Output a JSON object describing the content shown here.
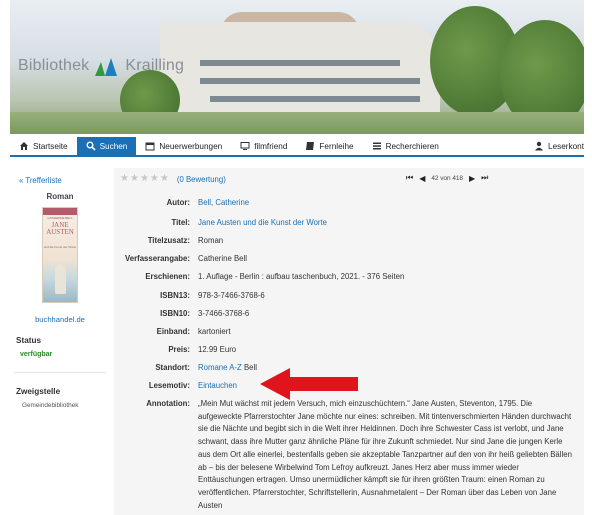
{
  "banner": {
    "logo_part1": "Bibliothek",
    "logo_part2": "Krailling"
  },
  "nav": {
    "items": [
      {
        "label": "Startseite",
        "icon": "home-icon"
      },
      {
        "label": "Suchen",
        "icon": "search-icon",
        "active": true
      },
      {
        "label": "Neuerwerbungen",
        "icon": "calendar-icon"
      },
      {
        "label": "filmfriend",
        "icon": "monitor-icon"
      },
      {
        "label": "Fernleihe",
        "icon": "book-icon"
      },
      {
        "label": "Recherchieren",
        "icon": "list-icon"
      },
      {
        "label": "Leserkont",
        "icon": "user-icon"
      }
    ]
  },
  "left": {
    "back": "« Trefferliste",
    "media_type": "Roman",
    "cover_publisher": "CATHERINE BELL",
    "cover_title_1": "JANE",
    "cover_title_2": "AUSTEN",
    "cover_subtitle": "und die Kunst der Worte",
    "buchhandel": "buchhandel.de",
    "status_heading": "Status",
    "status_value": "verfügbar",
    "branch_heading": "Zweigstelle",
    "branch_value": "Gemeindebibliothek"
  },
  "main": {
    "rating_text": "(0 Bewertung)",
    "pager_count": "42 von 418",
    "fields": [
      {
        "label": "Autor:",
        "value": "Bell, Catherine",
        "link": true
      },
      {
        "label": "Titel:",
        "value": "Jane Austen und die Kunst der Worte",
        "link": true
      },
      {
        "label": "Titelzusatz:",
        "value": "Roman",
        "link": false
      },
      {
        "label": "Verfasserangabe:",
        "value": "Catherine Bell",
        "link": false
      },
      {
        "label": "Erschienen:",
        "value": "1. Auflage - Berlin : aufbau taschenbuch, 2021. - 376 Seiten",
        "link": false
      },
      {
        "label": "ISBN13:",
        "value": "978-3-7466-3768-6",
        "link": false
      },
      {
        "label": "ISBN10:",
        "value": "3-7466-3768-6",
        "link": false
      },
      {
        "label": "Einband:",
        "value": "kartoniert",
        "link": false
      },
      {
        "label": "Preis:",
        "value": "12.99 Euro",
        "link": false
      },
      {
        "label": "Standort:",
        "value": "Romane A-Z",
        "value_extra": " Bell",
        "link": true
      },
      {
        "label": "Lesemotiv:",
        "value": "Eintauchen",
        "link": true
      }
    ],
    "annotation_label": "Annotation:",
    "annotation": "„Mein Mut wächst mit jedem Versuch, mich einzuschüchtern.“ Jane Austen, Steventon, 1795. Die aufgeweckte Pfarrerstochter Jane möchte nur eines: schreiben. Mit tintenverschmierten Händen durchwacht sie die Nächte und begibt sich in die Welt ihrer Heldinnen. Doch ihre Schwester Cass ist verlobt, und Jane schwant, dass ihre Mutter ganz ähnliche Pläne für ihre Zukunft schmiedet. Nur sind Jane die jungen Kerle aus dem Ort alle einerlei, bestenfalls geben sie akzeptable Tanzpartner auf den von ihr heiß geliebten Bällen ab – bis der belesene Wirbelwind Tom Lefroy aufkreuzt. Janes Herz aber muss immer wieder Enttäuschungen ertragen. Umso unermüdlicher kämpft sie für ihren größten Traum: einen Roman zu veröffentlichen. Pfarrerstochter, Schriftstellerin, Ausnahmetalent – Der Roman über das Leben von Jane Austen"
  },
  "colors": {
    "accent": "#1a6fb5",
    "status": "#2a8a2a",
    "arrow": "#e0151b"
  }
}
